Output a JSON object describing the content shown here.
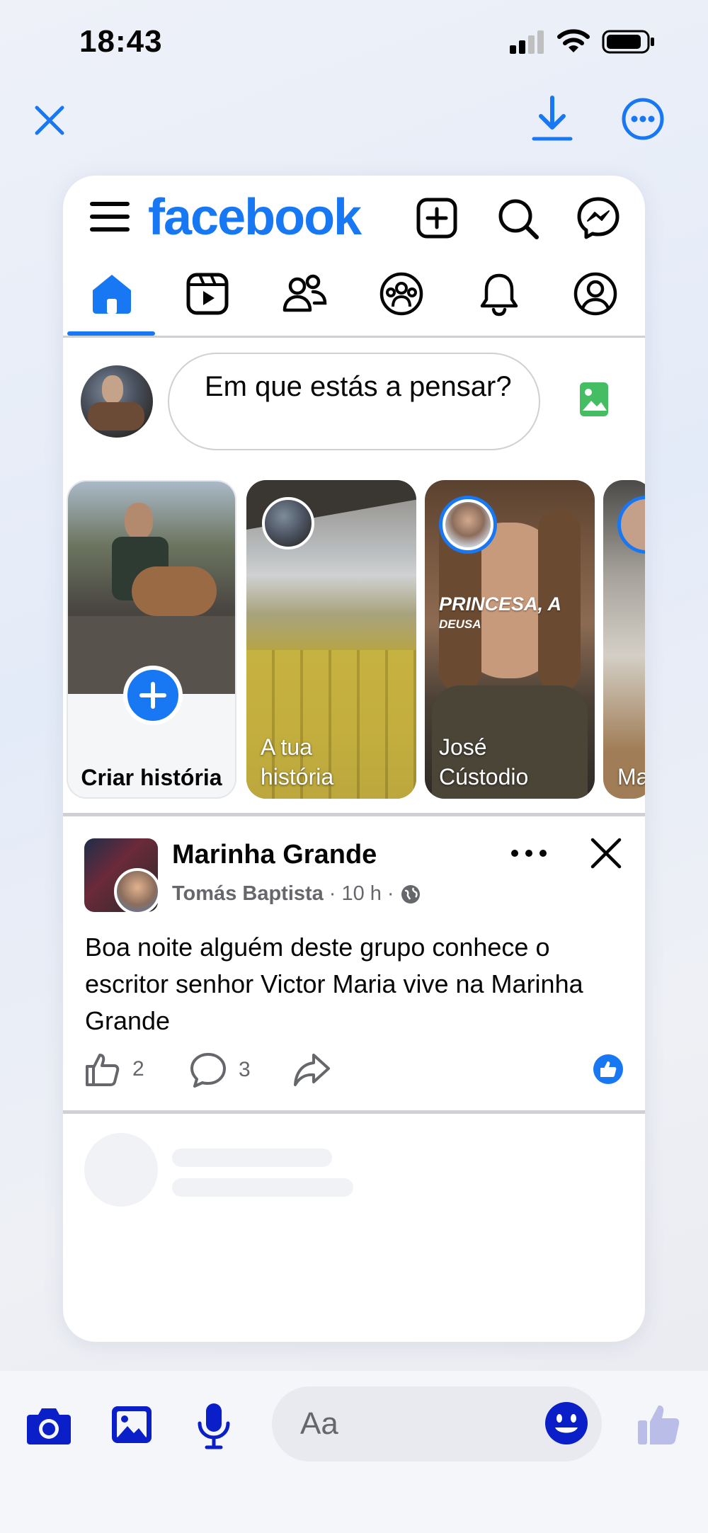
{
  "status_bar": {
    "time": "18:43"
  },
  "viewer": {
    "close_icon": "close-icon",
    "download_icon": "download-icon",
    "more_icon": "more-circle-icon"
  },
  "facebook": {
    "logo_text": "facebook",
    "brand_color": "#1877f2",
    "header_icons": [
      "menu-icon",
      "create-icon",
      "search-icon",
      "messenger-icon"
    ],
    "nav_tabs": [
      "home-icon",
      "reels-icon",
      "friends-icon",
      "groups-icon",
      "notifications-icon",
      "profile-icon"
    ],
    "active_tab": "home",
    "composer": {
      "placeholder": "Em que estás a pensar?",
      "photo_icon": "photo-icon"
    },
    "stories": [
      {
        "label": "Criar história",
        "type": "create"
      },
      {
        "label": "A tua história",
        "type": "own"
      },
      {
        "label": "José Cústodio",
        "overlay_title": "PRINCESA, A",
        "overlay_sub": "DEUSA"
      },
      {
        "label": "Ma"
      }
    ],
    "post": {
      "group": "Marinha Grande",
      "author": "Tomás Baptista",
      "time": "10 h",
      "separator": "·",
      "text": "Boa noite alguém deste grupo conhece o escritor senhor Victor Maria vive na Marinha Grande",
      "likes": "2",
      "comments": "3"
    }
  },
  "composer_bar": {
    "placeholder": "Aa",
    "accent_color": "#0a1fc8",
    "icons": [
      "camera-icon",
      "gallery-icon",
      "microphone-icon",
      "emoji-icon",
      "thumbs-up-icon"
    ]
  }
}
